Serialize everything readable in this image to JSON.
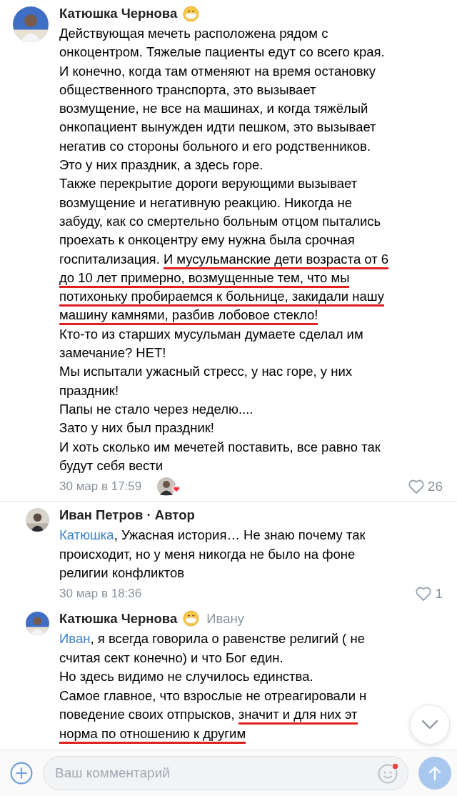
{
  "comments": [
    {
      "kind": "comment",
      "author": "Катюшка Чернова",
      "has_emoji": true,
      "lines": [
        [
          {
            "kind": "text",
            "text": "Действующая мечеть расположена рядом с"
          }
        ],
        [
          {
            "kind": "text",
            "text": "онкоцентром. Тяжелые пациенты едут со всего края."
          }
        ],
        [
          {
            "kind": "text",
            "text": "И конечно, когда там отменяют на время остановку"
          }
        ],
        [
          {
            "kind": "text",
            "text": "общественного транспорта, это вызывает"
          }
        ],
        [
          {
            "kind": "text",
            "text": "возмущение, не все на машинах, и когда тяжёлый"
          }
        ],
        [
          {
            "kind": "text",
            "text": "онкопациент вынужден идти пешком, это вызывает"
          }
        ],
        [
          {
            "kind": "text",
            "text": "негатив со стороны больного и его родственников."
          }
        ],
        [
          {
            "kind": "text",
            "text": "Это у них праздник, а здесь горе."
          }
        ],
        [
          {
            "kind": "text",
            "text": "Также перекрытие дороги верующими вызывает"
          }
        ],
        [
          {
            "kind": "text",
            "text": "возмущение и негативную реакцию. Никогда не"
          }
        ],
        [
          {
            "kind": "text",
            "text": "забуду, как со смертельно больным отцом пытались"
          }
        ],
        [
          {
            "kind": "text",
            "text": "проехать к онкоцентру ему нужна была срочная"
          }
        ],
        [
          {
            "kind": "text",
            "text": "госпитализация. "
          },
          {
            "kind": "marked",
            "text": "И мусульманские дети возраста от 6"
          }
        ],
        [
          {
            "kind": "marked",
            "text": "до 10 лет примерно, возмущенные тем, что мы"
          }
        ],
        [
          {
            "kind": "marked",
            "text": "потихоньку пробираемся к больнице, закидали нашу"
          }
        ],
        [
          {
            "kind": "marked",
            "text": "машину камнями, разбив лобовое стекло!"
          }
        ],
        [
          {
            "kind": "text",
            "text": "Кто-то из старших мусульман думаете сделал им"
          }
        ],
        [
          {
            "kind": "text",
            "text": "замечание? НЕТ!"
          }
        ],
        [
          {
            "kind": "text",
            "text": "Мы испытали ужасный стресс, у нас горе, у них"
          }
        ],
        [
          {
            "kind": "text",
            "text": "праздник!"
          }
        ],
        [
          {
            "kind": "text",
            "text": "Папы не стало через неделю...."
          }
        ],
        [
          {
            "kind": "text",
            "text": "Зато у них был праздник!"
          }
        ],
        [
          {
            "kind": "text",
            "text": "И хоть сколько им мечетей поставить, все равно так"
          }
        ],
        [
          {
            "kind": "text",
            "text": "будут себя вести"
          }
        ]
      ],
      "date": "30 мар в 17:59",
      "liked_by_avatar": true,
      "likes": "26"
    },
    {
      "kind": "reply",
      "author": "Иван Петров · Автор",
      "has_emoji": false,
      "lines": [
        [
          {
            "kind": "mention",
            "text": "Катюшка"
          },
          {
            "kind": "text",
            "text": ", Ужасная история… Не знаю почему так"
          }
        ],
        [
          {
            "kind": "text",
            "text": "происходит, но у меня никогда не было на фоне"
          }
        ],
        [
          {
            "kind": "text",
            "text": "религии конфликтов"
          }
        ]
      ],
      "date": "30 мар в 18:36",
      "liked_by_avatar": false,
      "likes": "1"
    },
    {
      "kind": "reply",
      "author": "Катюшка Чернова",
      "has_emoji": true,
      "reply_to": "Ивану",
      "lines": [
        [
          {
            "kind": "mention",
            "text": "Иван"
          },
          {
            "kind": "text",
            "text": ", я всегда говорила о равенстве религий ( не"
          }
        ],
        [
          {
            "kind": "text",
            "text": "считая сект конечно) и что Бог един."
          }
        ],
        [
          {
            "kind": "text",
            "text": "Но здесь видимо не случилось единства."
          }
        ],
        [
          {
            "kind": "text",
            "text": "Самое главное, что взрослые не отреагировали н"
          }
        ],
        [
          {
            "kind": "text",
            "text": "поведение своих отпрысков, "
          },
          {
            "kind": "marked",
            "text": "значит и для них эт"
          }
        ],
        [
          {
            "kind": "marked",
            "text": "норма по отношению к другим"
          }
        ]
      ]
    }
  ],
  "composer": {
    "placeholder": "Ваш комментарий",
    "emoji_badge": true
  }
}
